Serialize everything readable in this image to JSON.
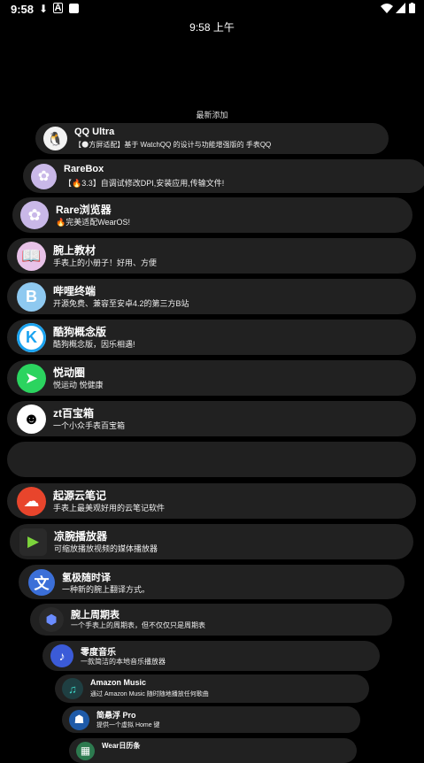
{
  "status_bar": {
    "time": "9:58"
  },
  "clock": "9:58 上午",
  "section_label": "最新添加",
  "apps": [
    {
      "title": "QQ Ultra",
      "desc": "【🌑方屏适配】基于 WatchQQ 的设计与功能增强版的 手表QQ",
      "icon": "qq-penguin-icon"
    },
    {
      "title": "RareBox",
      "desc": "【🔥3.3】自调试修改DPI,安装应用,传输文件!",
      "icon": "anime-girl-icon"
    },
    {
      "title": "Rare浏览器",
      "desc": "🔥完美适配WearOS!",
      "icon": "anime-girl-icon"
    },
    {
      "title": "腕上教材",
      "desc": "手表上的小册子！好用、方便",
      "icon": "book-icon"
    },
    {
      "title": "哔哩终端",
      "desc": "开源免费、兼容至安卓4.2的第三方B站",
      "icon": "bilibili-icon"
    },
    {
      "title": "酷狗概念版",
      "desc": "酷狗概念版，因乐相遇!",
      "icon": "kugou-icon"
    },
    {
      "title": "悦动圈",
      "desc": "悦运动 悦健康",
      "icon": "yuedong-icon"
    },
    {
      "title": "zt百宝箱",
      "desc": "一个小众手表百宝箱",
      "icon": "zt-logo-icon"
    },
    {
      "title": "",
      "desc": "",
      "icon": ""
    },
    {
      "title": "起源云笔记",
      "desc": "手表上最美观好用的云笔记软件",
      "icon": "cloud-note-icon"
    },
    {
      "title": "凉腕播放器",
      "desc": "可缩放播放视频的媒体播放器",
      "icon": "play-icon"
    },
    {
      "title": "氢极随时译",
      "desc": "一种新的腕上翻译方式。",
      "icon": "translate-icon"
    },
    {
      "title": "腕上周期表",
      "desc": "一个手表上的周期表，但不仅仅只是周期表",
      "icon": "atom-icon"
    },
    {
      "title": "零度音乐",
      "desc": "一款简洁的本地音乐播放器",
      "icon": "music-note-icon"
    },
    {
      "title": "Amazon Music",
      "desc": "通过 Amazon Music 随时随地播放任何歌曲",
      "icon": "amazon-music-icon"
    },
    {
      "title": "简悬浮 Pro",
      "desc": "提供一个虚拟 Home 键",
      "icon": "float-icon"
    },
    {
      "title": "Wear日历条",
      "desc": "",
      "icon": "calendar-icon"
    }
  ]
}
